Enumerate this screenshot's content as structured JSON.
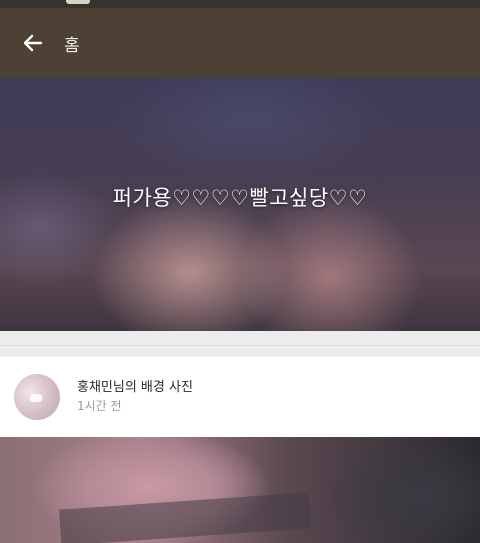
{
  "header": {
    "title": "홈",
    "back_icon": "arrow-left-icon"
  },
  "cover": {
    "text": "퍼가용♡♡♡♡빨고싶당♡♡"
  },
  "post": {
    "author_line": "홍채민님의 배경 사진",
    "time": "1시간 전"
  },
  "colors": {
    "app_bar": "#4d4035",
    "card": "#ffffff",
    "divider": "#ececec"
  }
}
